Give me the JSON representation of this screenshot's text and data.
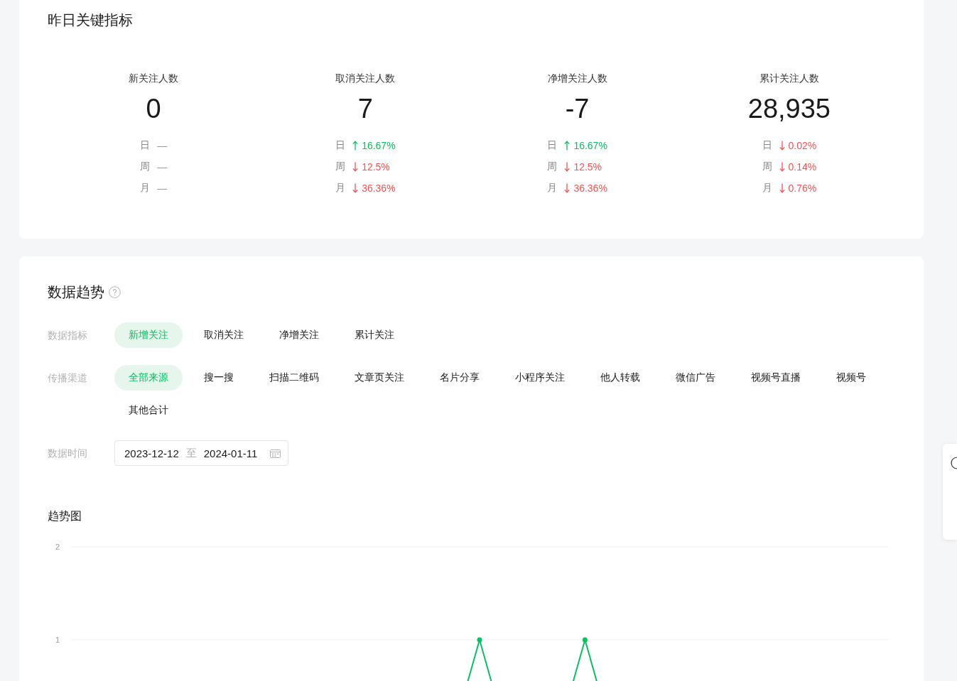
{
  "key_metrics": {
    "title": "昨日关键指标",
    "metrics": [
      {
        "label": "新关注人数",
        "value": "0",
        "changes": [
          {
            "period": "日",
            "kind": "none",
            "value": "—"
          },
          {
            "period": "周",
            "kind": "none",
            "value": "—"
          },
          {
            "period": "月",
            "kind": "none",
            "value": "—"
          }
        ]
      },
      {
        "label": "取消关注人数",
        "value": "7",
        "changes": [
          {
            "period": "日",
            "kind": "up",
            "value": "16.67%"
          },
          {
            "period": "周",
            "kind": "down",
            "value": "12.5%"
          },
          {
            "period": "月",
            "kind": "down",
            "value": "36.36%"
          }
        ]
      },
      {
        "label": "净增关注人数",
        "value": "-7",
        "changes": [
          {
            "period": "日",
            "kind": "up",
            "value": "16.67%"
          },
          {
            "period": "周",
            "kind": "down",
            "value": "12.5%"
          },
          {
            "period": "月",
            "kind": "down",
            "value": "36.36%"
          }
        ]
      },
      {
        "label": "累计关注人数",
        "value": "28,935",
        "changes": [
          {
            "period": "日",
            "kind": "down",
            "value": "0.02%"
          },
          {
            "period": "周",
            "kind": "down",
            "value": "0.14%"
          },
          {
            "period": "月",
            "kind": "down",
            "value": "0.76%"
          }
        ]
      }
    ]
  },
  "trend": {
    "title": "数据趋势",
    "filters": [
      {
        "label": "数据指标",
        "options": [
          {
            "label": "新增关注",
            "selected": true
          },
          {
            "label": "取消关注",
            "selected": false
          },
          {
            "label": "净增关注",
            "selected": false
          },
          {
            "label": "累计关注",
            "selected": false
          }
        ]
      },
      {
        "label": "传播渠道",
        "options": [
          {
            "label": "全部来源",
            "selected": true
          },
          {
            "label": "搜一搜",
            "selected": false
          },
          {
            "label": "扫描二维码",
            "selected": false
          },
          {
            "label": "文章页关注",
            "selected": false
          },
          {
            "label": "名片分享",
            "selected": false
          },
          {
            "label": "小程序关注",
            "selected": false
          },
          {
            "label": "他人转载",
            "selected": false
          },
          {
            "label": "微信广告",
            "selected": false
          },
          {
            "label": "视频号直播",
            "selected": false
          },
          {
            "label": "视频号",
            "selected": false
          },
          {
            "label": "其他合计",
            "selected": false
          }
        ]
      }
    ],
    "date_range": {
      "label": "数据时间",
      "start": "2023-12-12",
      "separator": "至",
      "end": "2024-01-11"
    },
    "trend_chart": {
      "title": "趋势图",
      "y_axis_labels": [
        "2",
        "1"
      ]
    }
  }
}
